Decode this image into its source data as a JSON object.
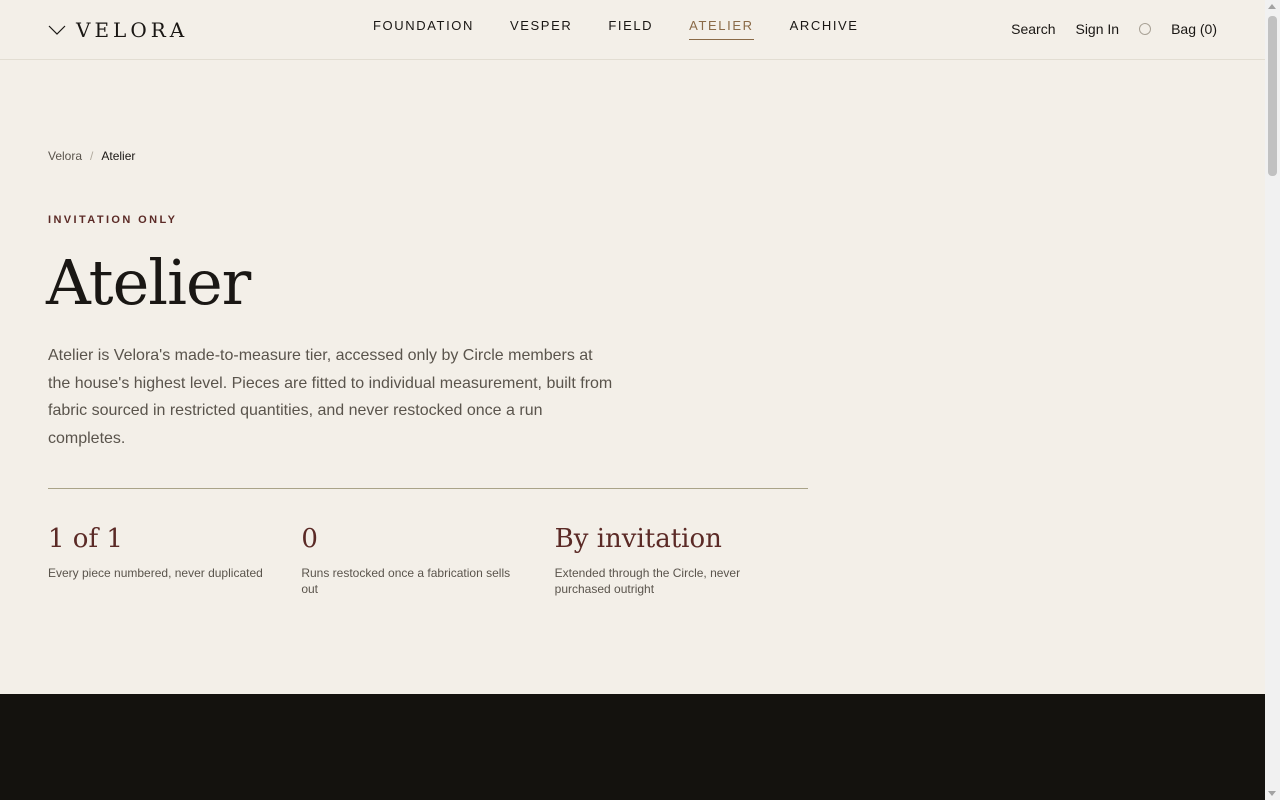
{
  "brand": {
    "name": "VELORA",
    "mark_icon": "chevron-down-icon"
  },
  "nav": {
    "items": [
      {
        "label": "FOUNDATION",
        "active": false
      },
      {
        "label": "VESPER",
        "active": false
      },
      {
        "label": "FIELD",
        "active": false
      },
      {
        "label": "ATELIER",
        "active": true
      },
      {
        "label": "ARCHIVE",
        "active": false
      }
    ]
  },
  "header": {
    "search_label": "Search",
    "signin_label": "Sign In",
    "account_icon": "circle-icon",
    "bag_label": "Bag (0)"
  },
  "breadcrumb": {
    "root": "Velora",
    "separator": "/",
    "current": "Atelier"
  },
  "hero": {
    "eyebrow": "INVITATION ONLY",
    "title": "Atelier",
    "intro": "Atelier is Velora's made-to-measure tier, accessed only by Circle members at the house's highest level. Pieces are fitted to individual measurement, built from fabric sourced in restricted quantities, and never restocked once a run completes."
  },
  "stats": [
    {
      "value": "1 of 1",
      "caption": "Every piece numbered, never duplicated"
    },
    {
      "value": "0",
      "caption": "Runs restocked once a fabrication sells out"
    },
    {
      "value": "By invitation",
      "caption": "Extended through the Circle, never purchased outright"
    }
  ],
  "colors": {
    "background": "#f3efe8",
    "accent": "#8a6a47",
    "burgundy": "#5b2a26",
    "text": "#1a1714",
    "muted": "#5a544c",
    "dark_band": "#14120e"
  }
}
